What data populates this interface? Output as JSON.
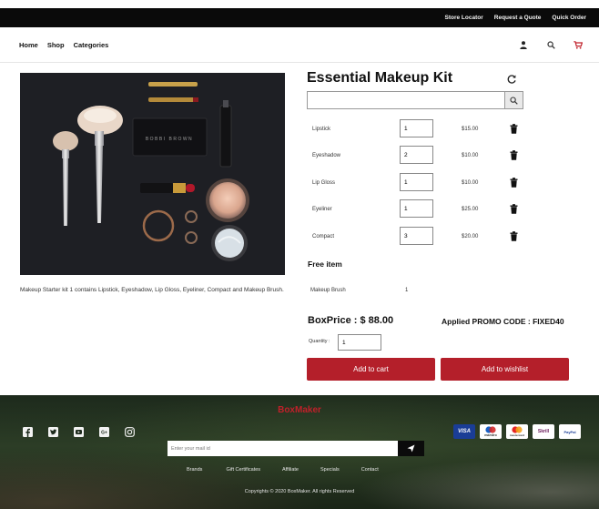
{
  "topbar": {
    "links": [
      "Store Locator",
      "Request a Quote",
      "Quick Order"
    ]
  },
  "nav": {
    "links": [
      "Home",
      "Shop",
      "Categories"
    ]
  },
  "icons": {
    "user": "user-icon",
    "search": "search-icon",
    "cart": "cart-icon",
    "refresh": "refresh-icon",
    "trash": "trash-icon",
    "send": "send-icon"
  },
  "colors": {
    "accent": "#b41f2a",
    "topbar": "#0a0a0a",
    "brand": "#c0202a"
  },
  "product": {
    "title": "Essential Makeup Kit",
    "description": "Makeup Starter kit 1 contains Lipstick, Eyeshadow, Lip Gloss, Eyeliner, Compact and Makeup Brush.",
    "search_placeholder": "",
    "items": [
      {
        "name": "Lipstick",
        "qty": "1",
        "price": "$15.00"
      },
      {
        "name": "Eyeshadow",
        "qty": "2",
        "price": "$10.00"
      },
      {
        "name": "Lip Gloss",
        "qty": "1",
        "price": "$10.00"
      },
      {
        "name": "Eyeliner",
        "qty": "1",
        "price": "$25.00"
      },
      {
        "name": "Compact",
        "qty": "3",
        "price": "$20.00"
      }
    ],
    "free_heading": "Free item",
    "free_item": {
      "name": "Makeup Brush",
      "qty": "1"
    },
    "box_price": "BoxPrice : $ 88.00",
    "promo": "Applied PROMO CODE : FIXED40",
    "quantity_label": "Quantity :",
    "quantity_value": "1",
    "add_to_cart": "Add to cart",
    "add_to_wishlist": "Add to wishlist"
  },
  "footer": {
    "brand": "BoxMaker",
    "newsletter_placeholder": "Enter your mail id",
    "links": [
      "Brands",
      "Gift Certificates",
      "Affiliate",
      "Specials",
      "Contact"
    ],
    "copyright": "Copyrights © 2020 BoxMaker. All rights Reserved",
    "payments": [
      "VISA",
      "maestro",
      "mastercard",
      "Skrill",
      "PayPal"
    ],
    "social": [
      "facebook-icon",
      "twitter-icon",
      "youtube-icon",
      "google-plus-icon",
      "instagram-icon"
    ]
  }
}
